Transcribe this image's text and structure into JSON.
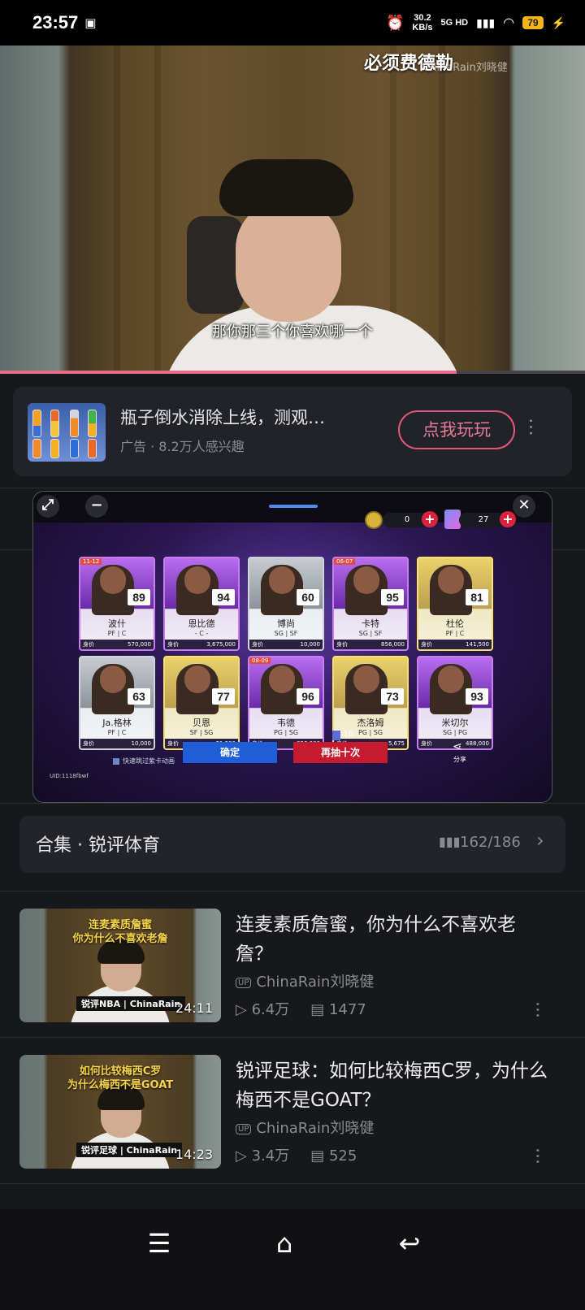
{
  "status_bar": {
    "time": "23:57",
    "speed_value": "30.2",
    "speed_unit": "KB/s",
    "network": "5G HD",
    "battery": "79"
  },
  "video": {
    "watermark": "必须费德勒",
    "channel_watermark": "ChinaRain刘晓健",
    "subtitle": "那你那三个你喜欢哪一个",
    "progress_percent": 78
  },
  "ad": {
    "title": "瓶子倒水消除上线，测观…",
    "meta": "广告 · 8.2万人感兴趣",
    "cta": "点我玩玩"
  },
  "game": {
    "coins": "0",
    "tickets": "27",
    "cards": [
      {
        "name": "波什",
        "pos": "PF | C",
        "ovr": "89",
        "price": "570,000",
        "tier": "purple",
        "badge": "11-12"
      },
      {
        "name": "恩比德",
        "pos": "- C -",
        "ovr": "94",
        "price": "3,675,000",
        "tier": "purple",
        "badge": ""
      },
      {
        "name": "博尚",
        "pos": "SG | SF",
        "ovr": "60",
        "price": "10,000",
        "tier": "silver",
        "badge": ""
      },
      {
        "name": "卡特",
        "pos": "SG | SF",
        "ovr": "95",
        "price": "856,000",
        "tier": "purple",
        "badge": "06-07"
      },
      {
        "name": "杜伦",
        "pos": "PF | C",
        "ovr": "81",
        "price": "141,500",
        "tier": "gold",
        "badge": ""
      },
      {
        "name": "Ja.格林",
        "pos": "PF | C",
        "ovr": "63",
        "price": "10,000",
        "tier": "silver",
        "badge": ""
      },
      {
        "name": "贝恩",
        "pos": "SF | SG",
        "ovr": "77",
        "price": "31,200",
        "tier": "gold",
        "badge": ""
      },
      {
        "name": "韦德",
        "pos": "PG | SG",
        "ovr": "96",
        "price": "896,000",
        "tier": "purple",
        "badge": "08-09"
      },
      {
        "name": "杰洛姆",
        "pos": "PG | SG",
        "ovr": "73",
        "price": "5,675",
        "tier": "gold",
        "badge": ""
      },
      {
        "name": "米切尔",
        "pos": "SG | PG",
        "ovr": "93",
        "price": "488,000",
        "tier": "purple",
        "badge": ""
      }
    ],
    "price_label": "身价",
    "count": "10",
    "skip_label": "快速跳过紫卡动画",
    "confirm": "确定",
    "redraw": "再抽十次",
    "share": "分享",
    "uid": "UID:1118fbwf"
  },
  "collection": {
    "title": "合集 · 锐评体育",
    "count": "162/186"
  },
  "videos": [
    {
      "caption_line1": "连麦素质詹蜜",
      "caption_line2": "你为什么不喜欢老詹",
      "tag": "锐评NBA | ChinaRain",
      "duration": "24:11",
      "title": "连麦素质詹蜜，你为什么不喜欢老詹？",
      "uploader": "ChinaRain刘晓健",
      "views": "6.4万",
      "comments": "1477"
    },
    {
      "caption_line1": "如何比较梅西C罗",
      "caption_line2": "为什么梅西不是GOAT",
      "tag": "锐评足球 | ChinaRain",
      "duration": "14:23",
      "title": "锐评足球：如何比较梅西C罗，为什么梅西不是GOAT？",
      "uploader": "ChinaRain刘晓健",
      "views": "3.4万",
      "comments": "525"
    }
  ],
  "up_label": "UP"
}
